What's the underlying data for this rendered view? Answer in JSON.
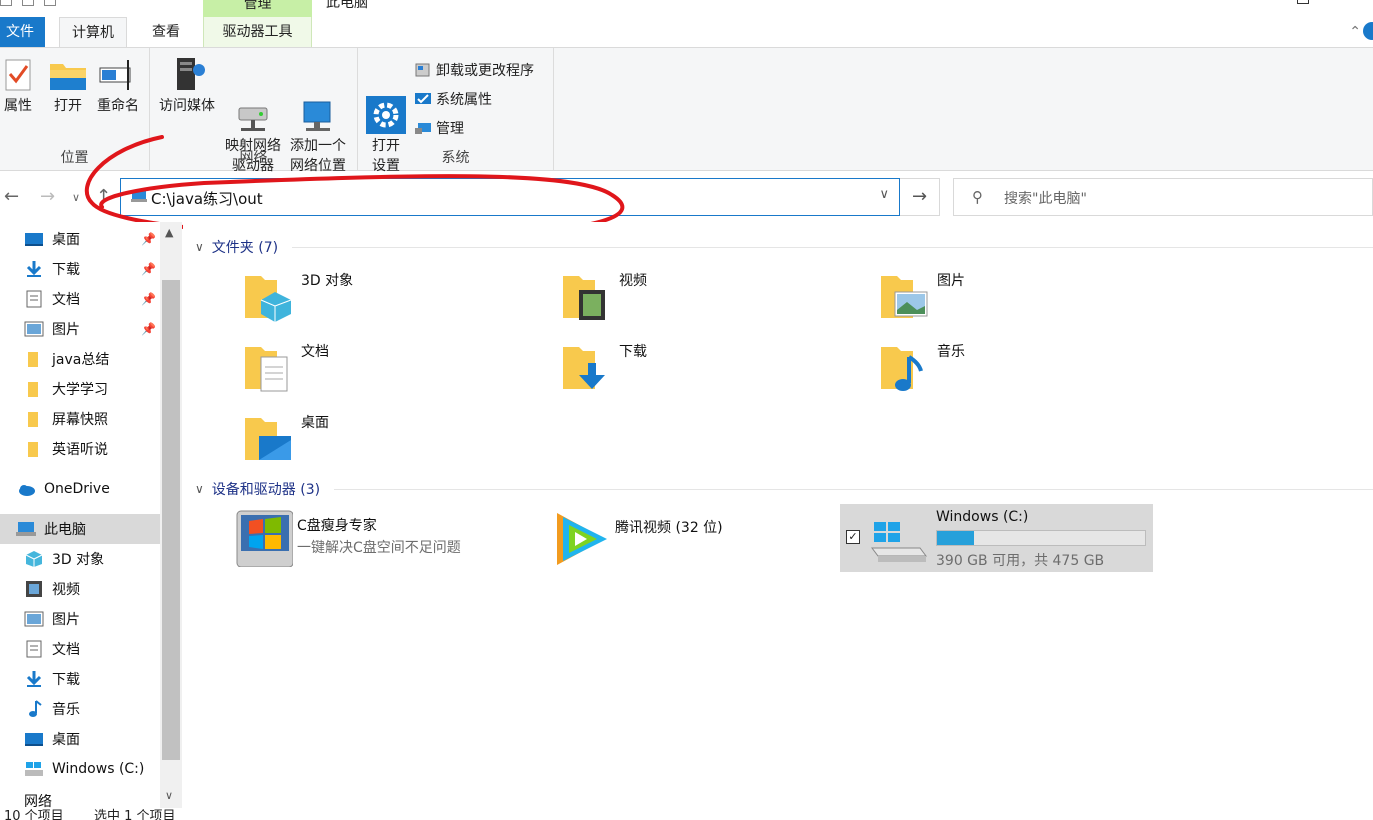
{
  "window": {
    "title": "此电脑",
    "context_tab_group": "管理"
  },
  "tabs": [
    {
      "label": "文件"
    },
    {
      "label": "计算机"
    },
    {
      "label": "查看"
    },
    {
      "label": "驱动器工具"
    }
  ],
  "ribbon": {
    "groups": [
      {
        "label": "位置",
        "buttons": [
          "属性",
          "打开",
          "重命名"
        ]
      },
      {
        "label": "网络",
        "buttons": [
          "访问媒体",
          "映射网络\n驱动器",
          "添加一个\n网络位置"
        ]
      },
      {
        "label": "系统",
        "buttons": [
          "打开\n设置"
        ],
        "small_buttons": [
          "卸载或更改程序",
          "系统属性",
          "管理"
        ]
      }
    ]
  },
  "address": {
    "path": "C:\\java练习\\out"
  },
  "search": {
    "placeholder": "搜索\"此电脑\""
  },
  "sidebar": {
    "quick_access": [
      {
        "label": "桌面",
        "icon": "desktop-icon",
        "pinned": true
      },
      {
        "label": "下载",
        "icon": "download-icon",
        "pinned": true
      },
      {
        "label": "文档",
        "icon": "document-icon",
        "pinned": true
      },
      {
        "label": "图片",
        "icon": "picture-icon",
        "pinned": true
      },
      {
        "label": "java总结",
        "icon": "folder-icon",
        "pinned": false
      },
      {
        "label": "大学学习",
        "icon": "folder-icon",
        "pinned": false
      },
      {
        "label": "屏幕快照",
        "icon": "folder-icon",
        "pinned": false
      },
      {
        "label": "英语听说",
        "icon": "folder-icon",
        "pinned": false
      }
    ],
    "onedrive": "OneDrive",
    "this_pc": "此电脑",
    "this_pc_children": [
      {
        "label": "3D 对象",
        "icon": "3d-objects-icon"
      },
      {
        "label": "视频",
        "icon": "video-icon"
      },
      {
        "label": "图片",
        "icon": "picture-icon"
      },
      {
        "label": "文档",
        "icon": "document-icon"
      },
      {
        "label": "下载",
        "icon": "download-icon"
      },
      {
        "label": "音乐",
        "icon": "music-icon"
      },
      {
        "label": "桌面",
        "icon": "desktop-icon"
      },
      {
        "label": "Windows  (C:)",
        "icon": "drive-icon"
      }
    ],
    "partial_item": "网络"
  },
  "main": {
    "folders_header": "文件夹 (7)",
    "folders": [
      {
        "label": "3D 对象",
        "icon": "3d-objects-folder-icon"
      },
      {
        "label": "视频",
        "icon": "video-folder-icon"
      },
      {
        "label": "图片",
        "icon": "pictures-folder-icon"
      },
      {
        "label": "文档",
        "icon": "documents-folder-icon"
      },
      {
        "label": "下载",
        "icon": "downloads-folder-icon"
      },
      {
        "label": "音乐",
        "icon": "music-folder-icon"
      },
      {
        "label": "桌面",
        "icon": "desktop-folder-icon"
      }
    ],
    "devices_header": "设备和驱动器 (3)",
    "devices": [
      {
        "title": "C盘瘦身专家",
        "subtitle": "一键解决C盘空间不足问题",
        "icon": "c-drive-cleaner-icon"
      },
      {
        "title": "腾讯视频 (32 位)",
        "subtitle": "",
        "icon": "tencent-video-icon"
      },
      {
        "title": "Windows  (C:)",
        "subtitle": "390 GB 可用，共 475 GB",
        "icon": "drive-icon",
        "used_fraction": 0.18,
        "selected": true
      }
    ]
  },
  "status": {
    "item_count": "10 个项目",
    "selected": "选中 1 个项目"
  },
  "colors": {
    "accent": "#1979ca",
    "folder": "#f8c94d",
    "context_tab": "#c7efa6",
    "capacity": "#26a0da",
    "annotation": "#e0161b"
  }
}
